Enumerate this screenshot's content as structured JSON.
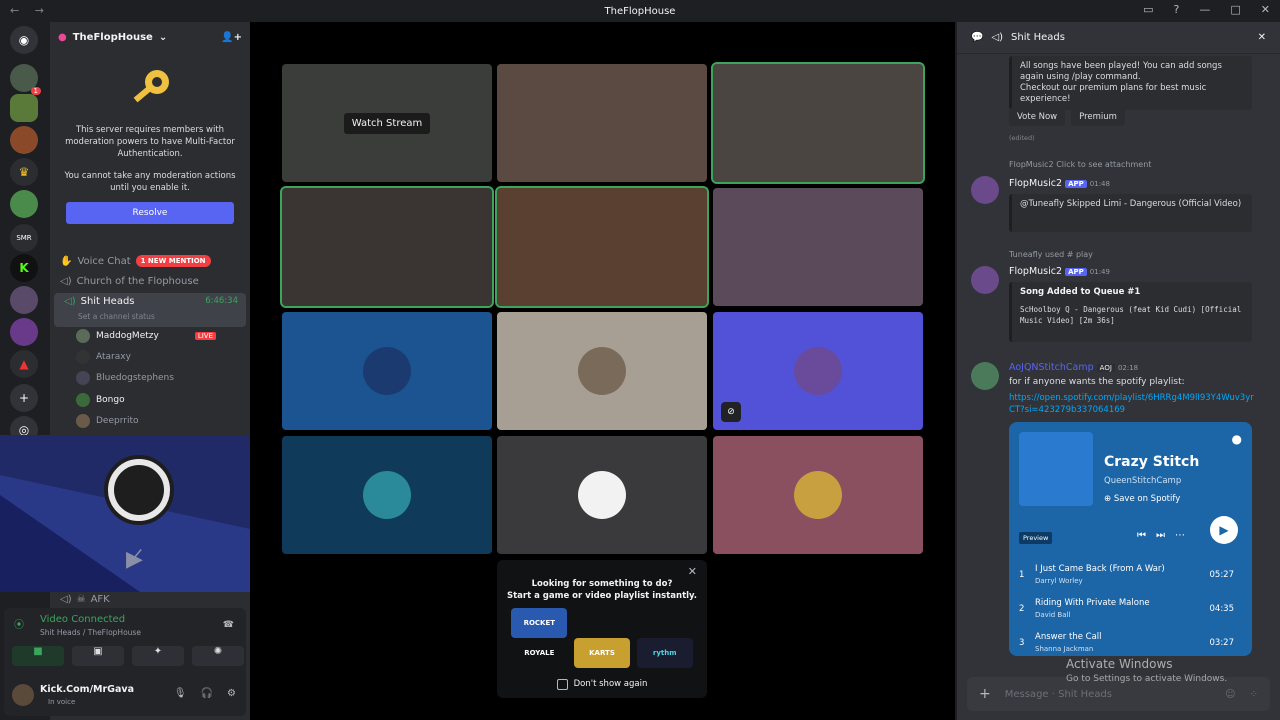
{
  "window": {
    "title": "TheFlopHouse",
    "nav": "← →"
  },
  "server": {
    "name": "TheFlopHouse"
  },
  "mfa": {
    "text1": "This server requires members with moderation powers to have Multi-Factor Authentication.",
    "text2": "You cannot take any moderation actions until you enable it.",
    "button": "Resolve"
  },
  "channels": {
    "voice_chat": "Voice Chat",
    "mention_badge": "1 NEW MENTION",
    "church": "Church of the Flophouse",
    "current": "Shit Heads",
    "timer": "6:46:34",
    "status_hint": "Set a channel status",
    "afk": "AFK"
  },
  "members": [
    {
      "name": "MaddogMetzy",
      "live": "LIVE"
    },
    {
      "name": "Ataraxy"
    },
    {
      "name": "Bluedogstephens"
    },
    {
      "name": "Bongo"
    },
    {
      "name": "Deeprrito"
    }
  ],
  "servers_badges": {
    "top": "1"
  },
  "voice": {
    "status": "Video Connected",
    "location": "Shit Heads / TheFlopHouse"
  },
  "user": {
    "name": "Kick.Com/MrGava",
    "status": "In voice"
  },
  "stage": {
    "watch_stream": "Watch Stream"
  },
  "popup": {
    "title": "Looking for something to do?",
    "subtitle": "Start a game or video playlist instantly.",
    "dont_show": "Don't show again",
    "activities": [
      "ROCKET ROYALE",
      "KARTS",
      "rythm"
    ]
  },
  "chat": {
    "channel": "Shit Heads",
    "notice": "All songs have been played! You can add songs again using /play command.\nCheckout our premium plans for best music experience!",
    "vote_button": "Vote Now",
    "premium_button": "Premium",
    "edited": "(edited)",
    "reply1": "FlopMusic2 Click to see attachment",
    "app_badge": "APP",
    "m1_name": "FlopMusic2",
    "m1_time": "01:48",
    "m1_embed": "@Tuneafly Skipped Limi - Dangerous (Official Video)",
    "reply2": "Tuneafly used # play",
    "m2_name": "FlopMusic2",
    "m2_time": "01:49",
    "m2_title": "Song Added to Queue #1",
    "m2_body": "ScHoolboy Q - Dangerous (feat Kid Cudi) [Official Music Video] [2m 36s]",
    "m3_name": "AoJQNStitchCamp",
    "m3_tag": "AOJ",
    "m3_time": "02:18",
    "m3_text": "for if anyone wants the spotify playlist:",
    "m3_link": "https://open.spotify.com/playlist/6HRRg4M9lI93Y4Wuv3yrCT?si=423279b337064169",
    "composer": "Message  · Shit Heads"
  },
  "spotify": {
    "title": "Crazy Stitch",
    "owner": "QueenStitchCamp",
    "save": "Save on Spotify",
    "preview": "Preview",
    "tracks": [
      {
        "n": "1",
        "title": "I Just Came Back (From A War)",
        "artist": "Darryl Worley",
        "time": "05:27"
      },
      {
        "n": "2",
        "title": "Riding With Private Malone",
        "artist": "David Ball",
        "time": "04:35"
      },
      {
        "n": "3",
        "title": "Answer the Call",
        "artist": "Shanna Jackman",
        "time": "03:27"
      }
    ]
  },
  "watermark": {
    "line1": "Activate Windows",
    "line2": "Go to Settings to activate Windows."
  }
}
